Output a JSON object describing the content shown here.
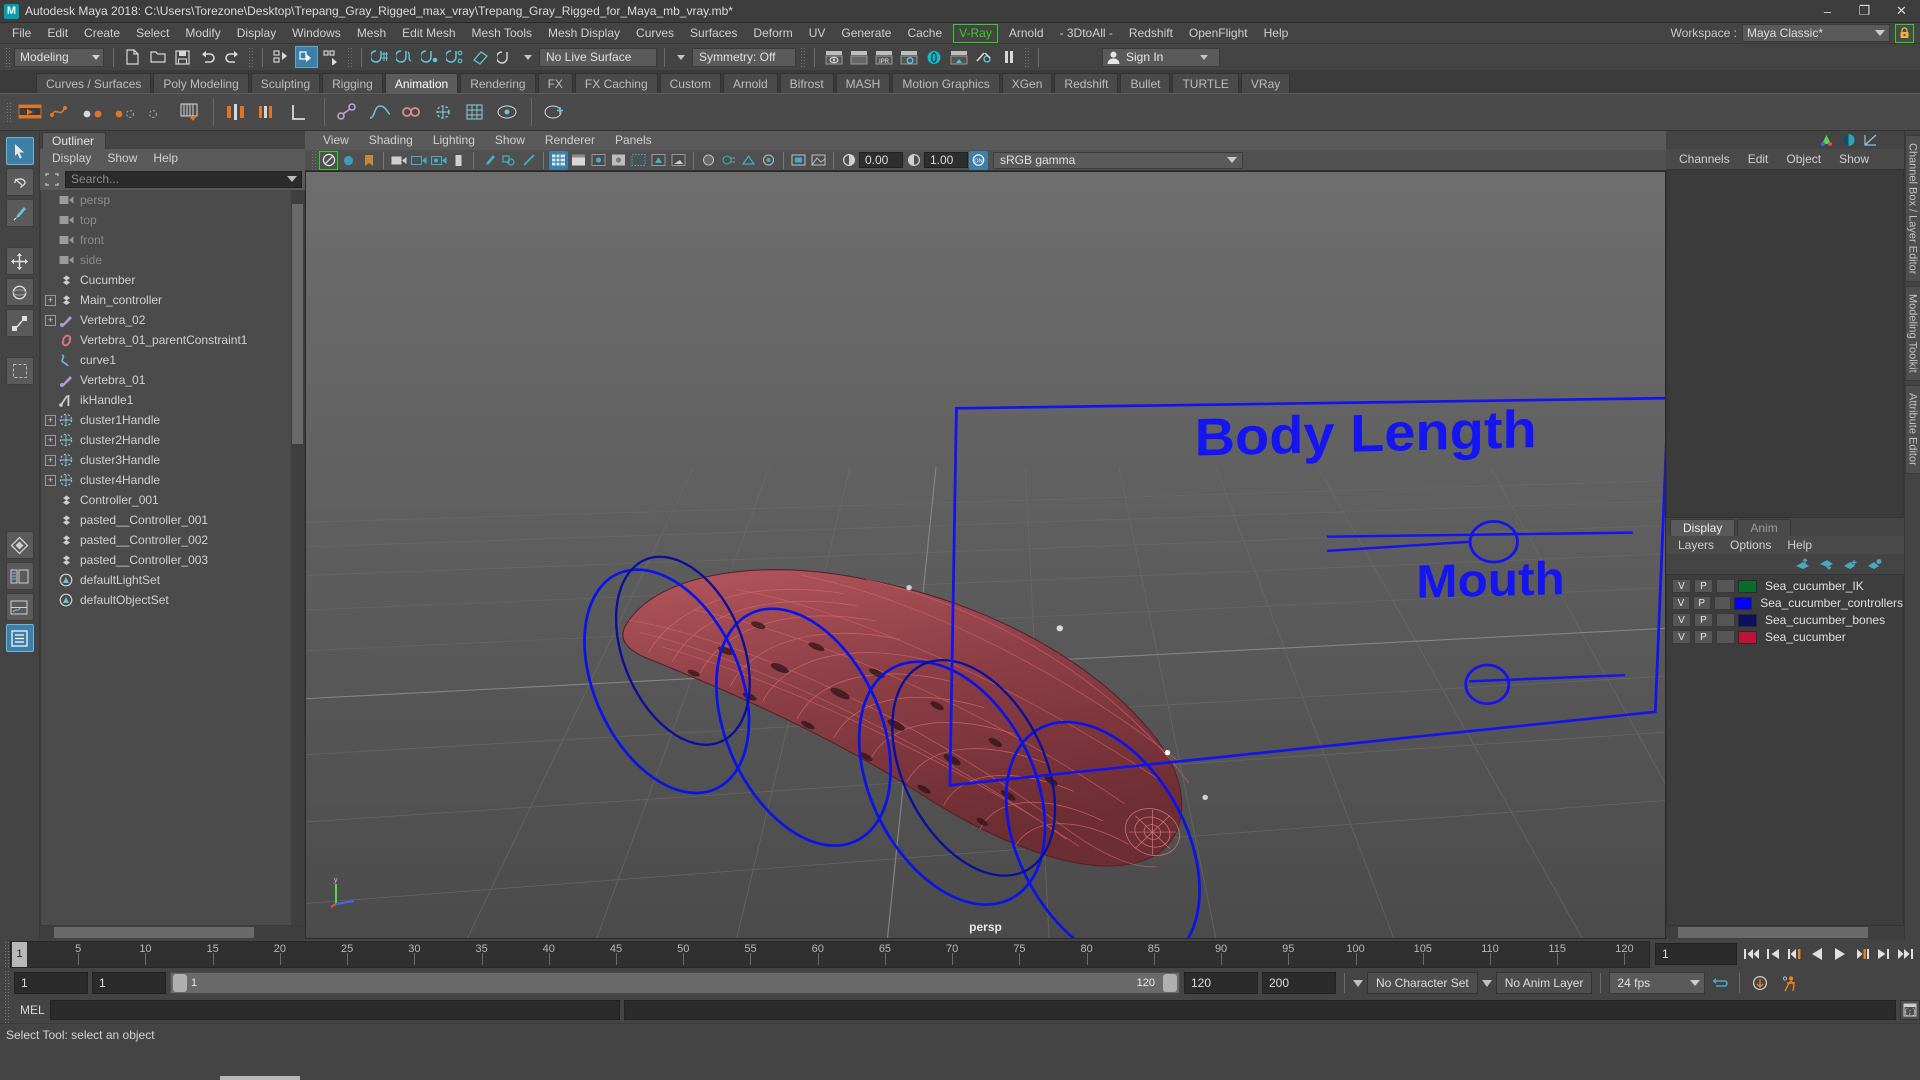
{
  "window": {
    "title": "Autodesk Maya 2018: C:\\Users\\Torezone\\Desktop\\Trepang_Gray_Rigged_max_vray\\Trepang_Gray_Rigged_for_Maya_mb_vray.mb*",
    "logo_text": "M",
    "minimize": "–",
    "maximize": "❐",
    "close": "✕"
  },
  "menubar": {
    "items": [
      {
        "label": "File"
      },
      {
        "label": "Edit"
      },
      {
        "label": "Create"
      },
      {
        "label": "Select"
      },
      {
        "label": "Modify"
      },
      {
        "label": "Display"
      },
      {
        "label": "Windows"
      },
      {
        "label": "Mesh"
      },
      {
        "label": "Edit Mesh"
      },
      {
        "label": "Mesh Tools"
      },
      {
        "label": "Mesh Display"
      },
      {
        "label": "Curves"
      },
      {
        "label": "Surfaces"
      },
      {
        "label": "Deform"
      },
      {
        "label": "UV"
      },
      {
        "label": "Generate"
      },
      {
        "label": "Cache"
      },
      {
        "label": "V-Ray",
        "boxed": true
      },
      {
        "label": "Arnold"
      },
      {
        "label": "- 3DtoAll -"
      },
      {
        "label": "Redshift"
      },
      {
        "label": "OpenFlight"
      },
      {
        "label": "Help"
      }
    ],
    "workspace_label": "Workspace :",
    "workspace_value": "Maya Classic*",
    "lock_icon": "lock-icon",
    "accent_green": "#2fd31f"
  },
  "statusline": {
    "menuset": "Modeling",
    "live_surface": "No Live Surface",
    "symmetry": "Symmetry: Off",
    "signin": "Sign In"
  },
  "shelf": {
    "tabs": [
      {
        "label": "Curves / Surfaces",
        "active": false
      },
      {
        "label": "Poly Modeling",
        "active": false
      },
      {
        "label": "Sculpting",
        "active": false
      },
      {
        "label": "Rigging",
        "active": false
      },
      {
        "label": "Animation",
        "active": true
      },
      {
        "label": "Rendering",
        "active": false
      },
      {
        "label": "FX",
        "active": false
      },
      {
        "label": "FX Caching",
        "active": false
      },
      {
        "label": "Custom",
        "active": false
      },
      {
        "label": "Arnold",
        "active": false
      },
      {
        "label": "Bifrost",
        "active": false
      },
      {
        "label": "MASH",
        "active": false
      },
      {
        "label": "Motion Graphics",
        "active": false
      },
      {
        "label": "XGen",
        "active": false
      },
      {
        "label": "Redshift",
        "active": false
      },
      {
        "label": "Bullet",
        "active": false
      },
      {
        "label": "TURTLE",
        "active": false
      },
      {
        "label": "VRay",
        "active": false
      }
    ]
  },
  "outliner": {
    "tab_label": "Outliner",
    "menus": [
      {
        "label": "Display"
      },
      {
        "label": "Show"
      },
      {
        "label": "Help"
      }
    ],
    "search_placeholder": "Search...",
    "items": [
      {
        "label": "persp",
        "icon": "camera-icon",
        "expand": false,
        "dim": true
      },
      {
        "label": "top",
        "icon": "camera-icon",
        "expand": false,
        "dim": true
      },
      {
        "label": "front",
        "icon": "camera-icon",
        "expand": false,
        "dim": true
      },
      {
        "label": "side",
        "icon": "camera-icon",
        "expand": false,
        "dim": true
      },
      {
        "label": "Cucumber",
        "icon": "transform-icon",
        "expand": false,
        "dim": false
      },
      {
        "label": "Main_controller",
        "icon": "transform-icon",
        "expand": true,
        "dim": false
      },
      {
        "label": "Vertebra_02",
        "icon": "joint-icon",
        "expand": true,
        "dim": false
      },
      {
        "label": "Vertebra_01_parentConstraint1",
        "icon": "constraint-icon",
        "expand": false,
        "dim": false
      },
      {
        "label": "curve1",
        "icon": "curve-icon",
        "expand": false,
        "dim": false
      },
      {
        "label": "Vertebra_01",
        "icon": "joint-icon",
        "expand": false,
        "dim": false
      },
      {
        "label": "ikHandle1",
        "icon": "ikhandle-icon",
        "expand": false,
        "dim": false
      },
      {
        "label": "cluster1Handle",
        "icon": "cluster-icon",
        "expand": true,
        "dim": false
      },
      {
        "label": "cluster2Handle",
        "icon": "cluster-icon",
        "expand": true,
        "dim": false
      },
      {
        "label": "cluster3Handle",
        "icon": "cluster-icon",
        "expand": true,
        "dim": false
      },
      {
        "label": "cluster4Handle",
        "icon": "cluster-icon",
        "expand": true,
        "dim": false
      },
      {
        "label": "Controller_001",
        "icon": "transform-icon",
        "expand": false,
        "dim": false
      },
      {
        "label": "pasted__Controller_001",
        "icon": "transform-icon",
        "expand": false,
        "dim": false
      },
      {
        "label": "pasted__Controller_002",
        "icon": "transform-icon",
        "expand": false,
        "dim": false
      },
      {
        "label": "pasted__Controller_003",
        "icon": "transform-icon",
        "expand": false,
        "dim": false
      },
      {
        "label": "defaultLightSet",
        "icon": "set-icon",
        "expand": false,
        "dim": false
      },
      {
        "label": "defaultObjectSet",
        "icon": "set-icon",
        "expand": false,
        "dim": false
      }
    ]
  },
  "viewport": {
    "menus": [
      {
        "label": "View"
      },
      {
        "label": "Shading"
      },
      {
        "label": "Lighting"
      },
      {
        "label": "Show"
      },
      {
        "label": "Renderer"
      },
      {
        "label": "Panels"
      }
    ],
    "exposure": "0.00",
    "gamma_value": "1.00",
    "color_space": "sRGB gamma",
    "camera_label": "persp",
    "annotations": [
      {
        "text": "Body Length",
        "color": "#1d1dff"
      },
      {
        "text": "Mouth",
        "color": "#1d1dff"
      }
    ],
    "mesh_color": "#a8383f",
    "controller_color": "#0000ff"
  },
  "channelbox": {
    "menus": [
      {
        "label": "Channels"
      },
      {
        "label": "Edit"
      },
      {
        "label": "Object"
      },
      {
        "label": "Show"
      }
    ],
    "icons": [
      "manipulator-icon",
      "channel-icon",
      "graph-icon"
    ]
  },
  "layers": {
    "tabs": [
      {
        "label": "Display",
        "active": true
      },
      {
        "label": "Anim",
        "active": false
      }
    ],
    "menus": [
      {
        "label": "Layers"
      },
      {
        "label": "Options"
      },
      {
        "label": "Help"
      }
    ],
    "buttons": [
      "move-layer-up-icon",
      "move-layer-down-icon",
      "new-layer-icon",
      "new-layer-from-selected-icon"
    ],
    "rows": [
      {
        "v": "V",
        "p": "P",
        "shade": "",
        "color": "#0a6b2a",
        "name": "Sea_cucumber_IK"
      },
      {
        "v": "V",
        "p": "P",
        "shade": "",
        "color": "#0000ff",
        "name": "Sea_cucumber_controllers"
      },
      {
        "v": "V",
        "p": "P",
        "shade": "",
        "color": "#0b1060",
        "name": "Sea_cucumber_bones"
      },
      {
        "v": "V",
        "p": "P",
        "shade": "",
        "color": "#c2103c",
        "name": "Sea_cucumber"
      }
    ]
  },
  "vtabs": [
    {
      "label": "Channel Box / Layer Editor"
    },
    {
      "label": "Modeling Toolkit"
    },
    {
      "label": "Attribute Editor"
    }
  ],
  "timeslider": {
    "current_frame": "1",
    "start_label": "1",
    "ticks": [
      5,
      10,
      15,
      20,
      25,
      30,
      35,
      40,
      45,
      50,
      55,
      60,
      65,
      70,
      75,
      80,
      85,
      90,
      95,
      100,
      105,
      110,
      115,
      120
    ],
    "frame_field": "1",
    "transport": [
      "go-to-start-icon",
      "step-back-keyframe-icon",
      "step-back-frame-icon",
      "play-backwards-icon",
      "play-forwards-icon",
      "step-forward-frame-icon",
      "step-forward-keyframe-icon",
      "go-to-end-icon"
    ]
  },
  "rangeslider": {
    "anim_start": "1",
    "range_start": "1",
    "bar_start_label": "1",
    "bar_end_label": "120",
    "range_end": "120",
    "anim_end": "200",
    "character_set": "No Character Set",
    "anim_layer": "No Anim Layer",
    "fps": "24 fps",
    "loop_icon": "loop-icon",
    "autokey_icon": "auto-keyframe-icon",
    "prefs_icon": "animation-preferences-icon"
  },
  "commandline": {
    "label": "MEL",
    "script_editor_icon": "script-editor-icon"
  },
  "helpline": {
    "text": "Select Tool: select an object"
  },
  "toolbox": {
    "tools": [
      {
        "name": "select-tool",
        "active": true
      },
      {
        "name": "lasso-tool",
        "active": false
      },
      {
        "name": "paint-select-tool",
        "active": false
      },
      {
        "name": "move-tool",
        "active": false
      },
      {
        "name": "rotate-tool",
        "active": false
      },
      {
        "name": "scale-tool",
        "active": false
      },
      {
        "name": "last-tool",
        "active": false
      },
      {
        "name": "four-view-layout",
        "active": false
      },
      {
        "name": "persp-outliner-layout",
        "active": false
      },
      {
        "name": "persp-graph-layout",
        "active": false
      },
      {
        "name": "persp-hypershade-layout",
        "active": true
      }
    ]
  }
}
